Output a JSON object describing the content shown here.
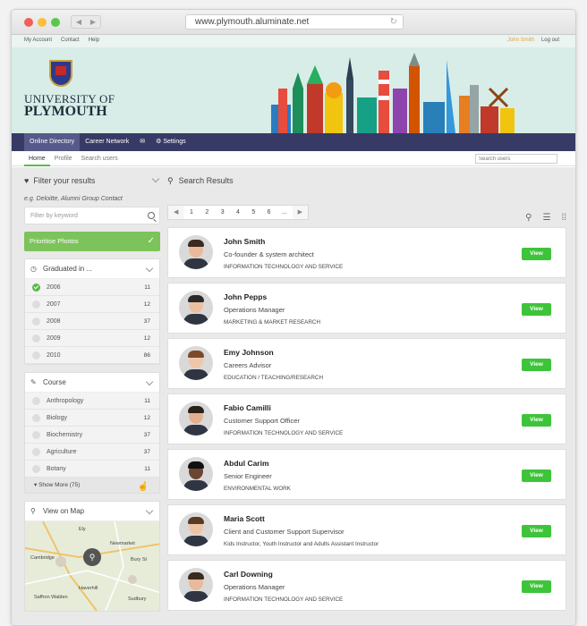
{
  "browser": {
    "url": "www.plymouth.aluminate.net"
  },
  "topbar": {
    "my_account": "My Account",
    "contact": "Contact",
    "help": "Help",
    "user": "John Smith",
    "logout": "Log out"
  },
  "brand": {
    "line1": "UNIVERSITY OF",
    "line2": "PLYMOUTH"
  },
  "mainnav": {
    "online_directory": "Online Directory",
    "career_network": "Career Network",
    "settings": "Settings"
  },
  "subnav": {
    "home": "Home",
    "profile": "Profile",
    "search_users": "Search users",
    "search_placeholder": "Search users"
  },
  "filter": {
    "title": "Filter your results",
    "example": "e.g. Deloitte, Alumni Group Contact",
    "keyword_placeholder": "Filter by keyword",
    "prioritise": "Prioritise Photos",
    "graduated": {
      "title": "Graduated in ...",
      "items": [
        {
          "label": "2006",
          "count": "11",
          "checked": true
        },
        {
          "label": "2007",
          "count": "12",
          "checked": false
        },
        {
          "label": "2008",
          "count": "37",
          "checked": false
        },
        {
          "label": "2009",
          "count": "12",
          "checked": false
        },
        {
          "label": "2010",
          "count": "86",
          "checked": false
        }
      ]
    },
    "course": {
      "title": "Course",
      "items": [
        {
          "label": "Anthropology",
          "count": "11"
        },
        {
          "label": "Biology",
          "count": "12"
        },
        {
          "label": "Biochemistry",
          "count": "37"
        },
        {
          "label": "Agriculture",
          "count": "37"
        },
        {
          "label": "Botany",
          "count": "11"
        }
      ],
      "show_more": "Show More (75)"
    },
    "map": {
      "title": "View on Map",
      "labels": [
        "Ely",
        "Cambridge",
        "Newmarket",
        "Bury St",
        "Haverhill",
        "Saffron Walden",
        "Sudbury"
      ]
    }
  },
  "results": {
    "title": "Search Results",
    "pager": [
      "◀",
      "1",
      "2",
      "3",
      "4",
      "5",
      "6",
      "...",
      "▶"
    ],
    "view_label": "View",
    "people": [
      {
        "name": "John Smith",
        "title": "Co-founder & system architect",
        "industry": "INFORMATION TECHNOLOGY AND SERVICE"
      },
      {
        "name": "John Pepps",
        "title": "Operations Manager",
        "industry": "MARKETING & MARKET RESEARCH"
      },
      {
        "name": "Emy Johnson",
        "title": "Careers Advisor",
        "industry": "EDUCATION / TEACHING/RESEARCH"
      },
      {
        "name": "Fabio Camilli",
        "title": "Customer Support Officer",
        "industry": "INFORMATION TECHNOLOGY AND SERVICE"
      },
      {
        "name": "Abdul Carim",
        "title": "Senior Engineer",
        "industry": "ENVIRONMENTAL WORK"
      },
      {
        "name": "Maria Scott",
        "title": "Client and Customer Support Supervisor",
        "industry": "Kids Instructor, Youth Instructor and Adults Assistant Instructor"
      },
      {
        "name": "Carl Downing",
        "title": "Operations Manager",
        "industry": "INFORMATION TECHNOLOGY AND SERVICE"
      }
    ]
  }
}
